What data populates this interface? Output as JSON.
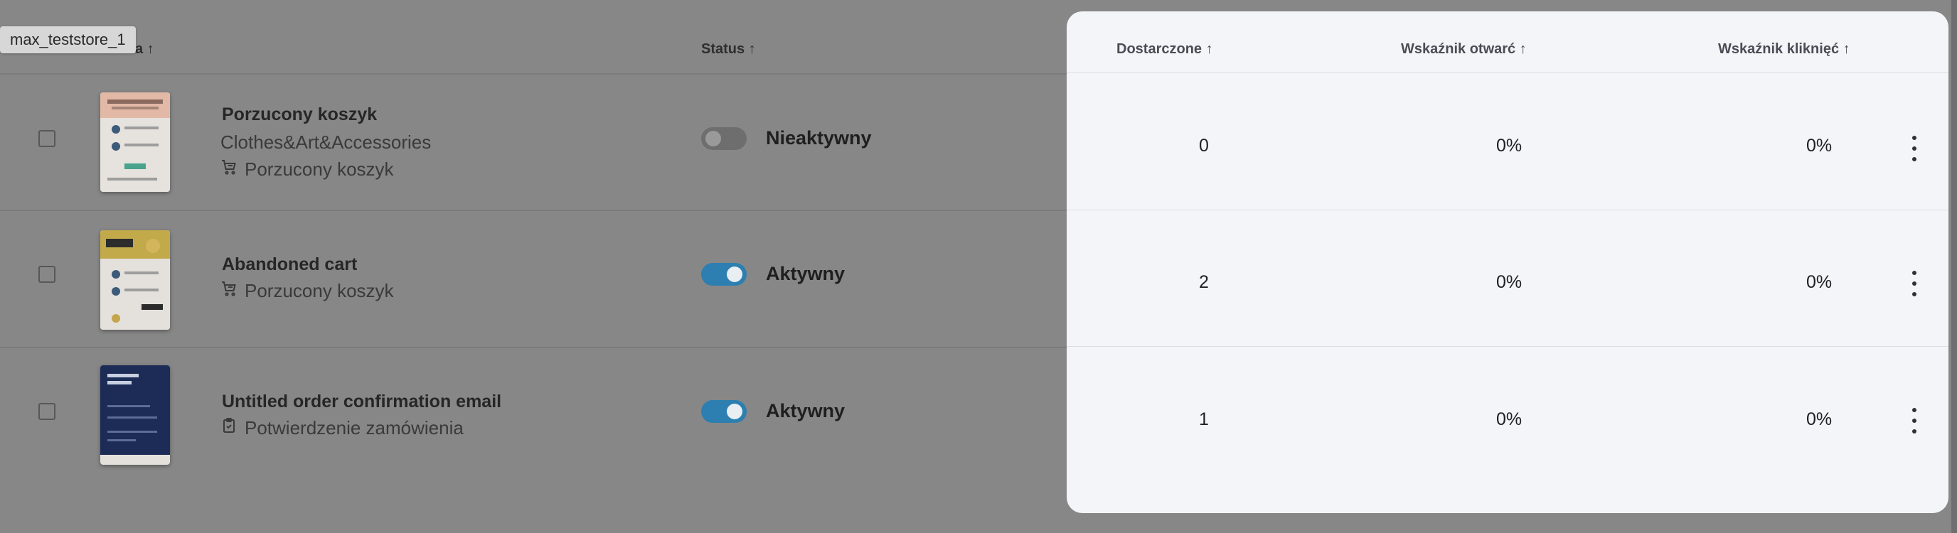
{
  "tooltip": "max_teststore_1",
  "columns": {
    "name_tail": "a ↑",
    "status": "Status ↑",
    "delivered": "Dostarczone ↑",
    "open_rate": "Wskaźnik otwarć ↑",
    "click_rate": "Wskaźnik kliknięć ↑"
  },
  "rows": [
    {
      "title": "Porzucony koszyk",
      "subtitle": "Clothes&Art&Accessories",
      "tag": "Porzucony koszyk",
      "tag_icon": "cart-icon",
      "status": "Nieaktywny",
      "status_on": false,
      "delivered": "0",
      "open_rate": "0%",
      "click_rate": "0%"
    },
    {
      "title": "Abandoned cart",
      "tag": "Porzucony koszyk",
      "tag_icon": "cart-icon",
      "status": "Aktywny",
      "status_on": true,
      "delivered": "2",
      "open_rate": "0%",
      "click_rate": "0%"
    },
    {
      "title": "Untitled order confirmation email",
      "tag": "Potwierdzenie zamówienia",
      "tag_icon": "clipboard-check-icon",
      "status": "Aktywny",
      "status_on": true,
      "delivered": "1",
      "open_rate": "0%",
      "click_rate": "0%"
    }
  ],
  "colors": {
    "overlay": "#878787",
    "card": "#f4f5f8",
    "toggle_on": "#2c7fb0"
  }
}
